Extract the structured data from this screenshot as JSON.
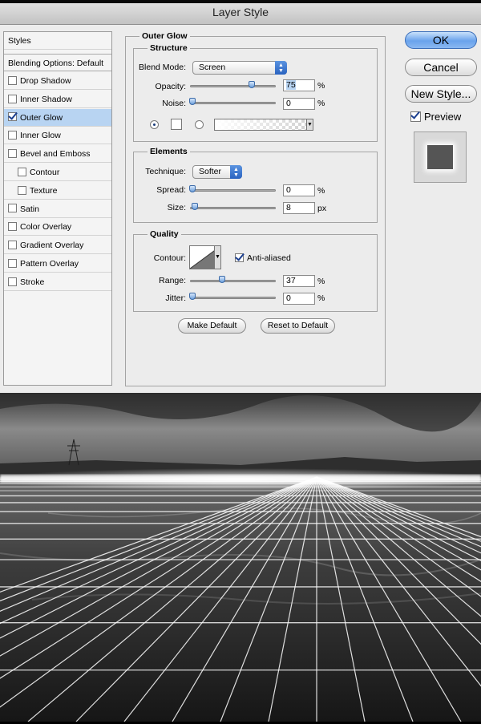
{
  "dialog": {
    "title": "Layer Style"
  },
  "styles_list": {
    "header": "Styles",
    "blending": "Blending Options: Default",
    "items": [
      {
        "label": "Drop Shadow",
        "checked": false
      },
      {
        "label": "Inner Shadow",
        "checked": false
      },
      {
        "label": "Outer Glow",
        "checked": true,
        "selected": true
      },
      {
        "label": "Inner Glow",
        "checked": false
      },
      {
        "label": "Bevel and Emboss",
        "checked": false
      },
      {
        "label": "Contour",
        "checked": false,
        "indent": true
      },
      {
        "label": "Texture",
        "checked": false,
        "indent": true
      },
      {
        "label": "Satin",
        "checked": false
      },
      {
        "label": "Color Overlay",
        "checked": false
      },
      {
        "label": "Gradient Overlay",
        "checked": false
      },
      {
        "label": "Pattern Overlay",
        "checked": false
      },
      {
        "label": "Stroke",
        "checked": false
      }
    ]
  },
  "outer_glow": {
    "title": "Outer Glow",
    "structure": {
      "title": "Structure",
      "blend_mode_label": "Blend Mode:",
      "blend_mode": "Screen",
      "opacity_label": "Opacity:",
      "opacity": "75",
      "opacity_level": 0.75,
      "noise_label": "Noise:",
      "noise": "0",
      "noise_level": 0,
      "percent": "%"
    },
    "elements": {
      "title": "Elements",
      "technique_label": "Technique:",
      "technique": "Softer",
      "spread_label": "Spread:",
      "spread": "0",
      "spread_level": 0,
      "size_label": "Size:",
      "size": "8",
      "size_level": 0.032,
      "percent": "%",
      "px": "px"
    },
    "quality": {
      "title": "Quality",
      "contour_label": "Contour:",
      "anti_aliased_label": "Anti-aliased",
      "anti_aliased": true,
      "range_label": "Range:",
      "range": "37",
      "range_level": 0.37,
      "jitter_label": "Jitter:",
      "jitter": "0",
      "jitter_level": 0,
      "percent": "%"
    },
    "make_default": "Make Default",
    "reset_default": "Reset to Default"
  },
  "actions": {
    "ok": "OK",
    "cancel": "Cancel",
    "new_style": "New Style...",
    "preview_label": "Preview",
    "preview_checked": true
  },
  "colors": {
    "accent": "#5a93e0",
    "selection": "#b8d4f2",
    "dialog_bg": "#ececec",
    "glow_line": "#ffffff"
  }
}
